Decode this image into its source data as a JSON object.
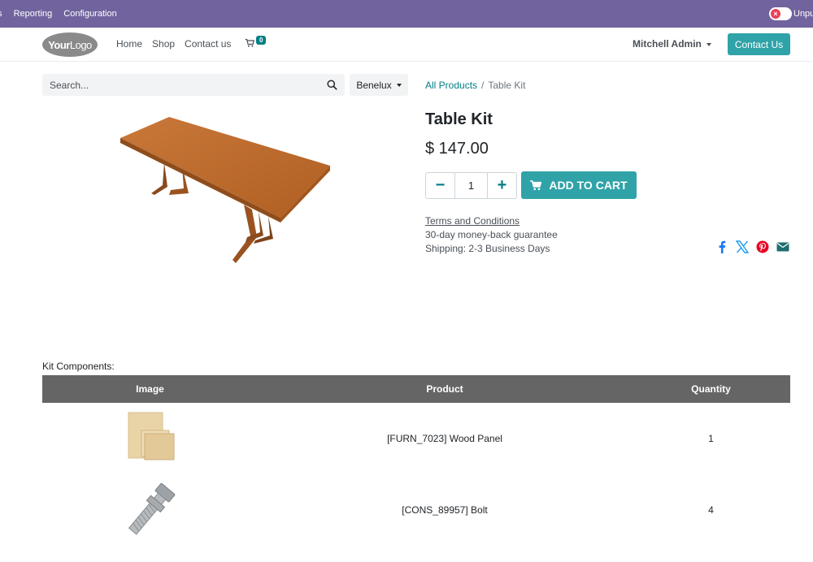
{
  "adminbar": {
    "menu": [
      "ts",
      "Reporting",
      "Configuration"
    ],
    "toggle_label": "Unpu"
  },
  "header": {
    "logo_text_a": "Your",
    "logo_text_b": "Logo",
    "nav": [
      "Home",
      "Shop",
      "Contact us"
    ],
    "cart_count": "0",
    "user": "Mitchell Admin",
    "contact_button": "Contact Us"
  },
  "search": {
    "placeholder": "Search...",
    "pricelist": "Benelux"
  },
  "breadcrumb": {
    "root": "All Products",
    "separator": "/",
    "current": "Table Kit"
  },
  "product": {
    "name": "Table Kit",
    "price": "$ 147.00",
    "quantity": "1",
    "decrease": "−",
    "increase": "+",
    "add_to_cart": "ADD TO CART",
    "terms": "Terms and Conditions",
    "guarantee": "30-day money-back guarantee",
    "shipping": "Shipping: 2-3 Business Days"
  },
  "share_icons": [
    "facebook-icon",
    "x-twitter-icon",
    "pinterest-icon",
    "email-icon"
  ],
  "kit": {
    "label": "Kit Components:",
    "headers": [
      "Image",
      "Product",
      "Quantity"
    ],
    "rows": [
      {
        "product": "[FURN_7023] Wood Panel",
        "quantity": "1"
      },
      {
        "product": "[CONS_89957] Bolt",
        "quantity": "4"
      }
    ]
  },
  "colors": {
    "adminbar": "#71639e",
    "primary": "#2fa3a8",
    "link": "#017e84",
    "table_header": "#656565"
  }
}
